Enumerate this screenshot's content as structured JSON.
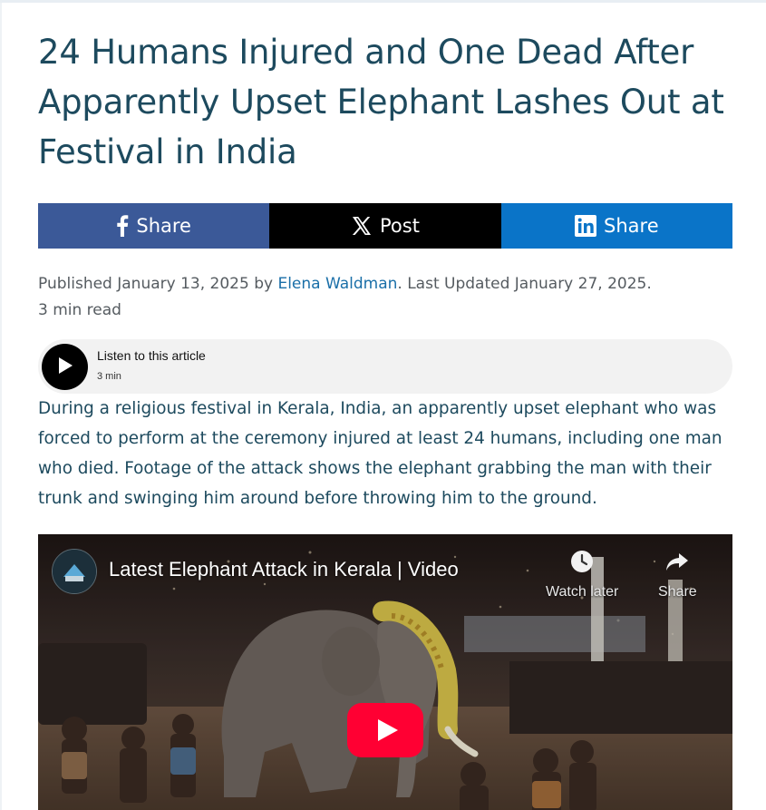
{
  "article": {
    "title": "24 Humans Injured and One Dead After Apparently Upset Elephant Lashes Out at Festival in India",
    "published_prefix": "Published January 13, 2025 by ",
    "author": "Elena Waldman",
    "updated_suffix": ". Last Updated January 27, 2025.",
    "read_time": "3 min read",
    "body": "During a religious festival in Kerala, India, an apparently upset elephant who was forced to perform at the ceremony injured at least 24 humans, including one man who died. Footage of the attack shows the elephant grabbing the man with their trunk and swinging him around before throwing him to the ground."
  },
  "share": {
    "facebook_label": "Share",
    "x_label": "Post",
    "linkedin_label": "Share",
    "colors": {
      "facebook": "#3b5998",
      "x": "#000000",
      "linkedin": "#0a74c8"
    }
  },
  "audio_player": {
    "title": "Listen to this article",
    "duration": "3 min",
    "icon": "play-icon"
  },
  "video": {
    "title": "Latest Elephant Attack in Kerala | Video",
    "watch_later_label": "Watch later",
    "share_label": "Share",
    "play_icon": "youtube-play-icon",
    "accent": "#ff0033"
  },
  "colors": {
    "title": "#1d4a5e",
    "link": "#1a6fa8",
    "meta": "#555b60"
  }
}
